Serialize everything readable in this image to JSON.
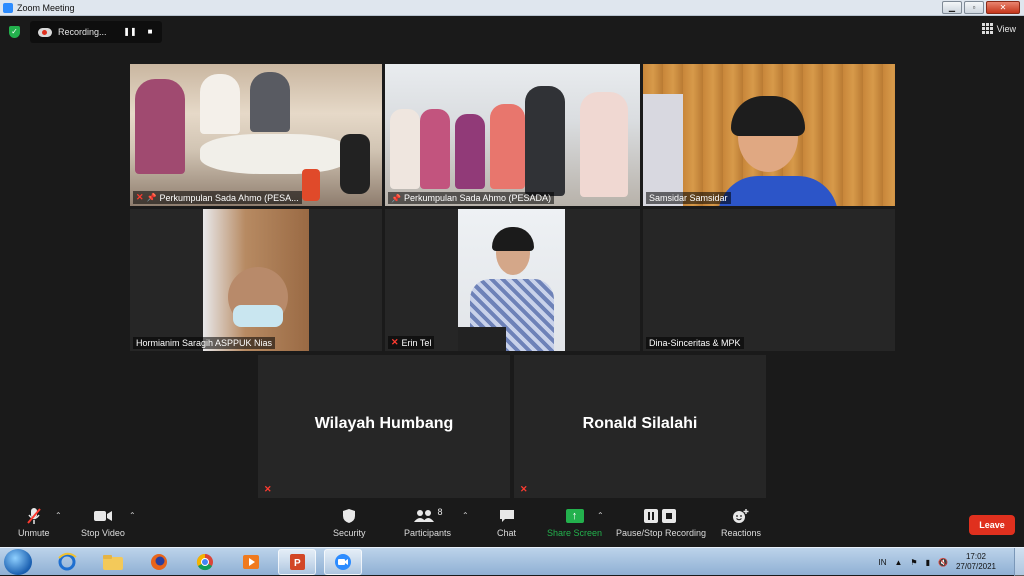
{
  "window": {
    "title": "Zoom Meeting"
  },
  "recording": {
    "label": "Recording...",
    "pause": "❚❚",
    "stop": "■"
  },
  "view": {
    "label": "View"
  },
  "participants_tiles": [
    {
      "name": "Perkumpulan Sada Ahmo (PESA..."
    },
    {
      "name": "Perkumpulan Sada Ahmo (PESADA)"
    },
    {
      "name": "Samsidar Samsidar"
    },
    {
      "name": "Hormianim Saragih ASPPUK Nias"
    },
    {
      "name": "Erin Tel"
    },
    {
      "name": "Dina-Sinceritas & MPK"
    },
    {
      "name": "Wilayah Humbang"
    },
    {
      "name": "Ronald Silalahi"
    }
  ],
  "toolbar": {
    "unmute": "Unmute",
    "stop_video": "Stop Video",
    "security": "Security",
    "participants": "Participants",
    "participants_count": "8",
    "chat": "Chat",
    "share_screen": "Share Screen",
    "pause_stop_recording": "Pause/Stop Recording",
    "reactions": "Reactions",
    "leave": "Leave"
  },
  "taskbar": {
    "language": "IN",
    "time": "17:02",
    "date": "27/07/2021"
  },
  "colors": {
    "active_speaker": "#c6e83a",
    "leave": "#e0301e",
    "share": "#23b14d",
    "mute": "#ff3b30"
  }
}
